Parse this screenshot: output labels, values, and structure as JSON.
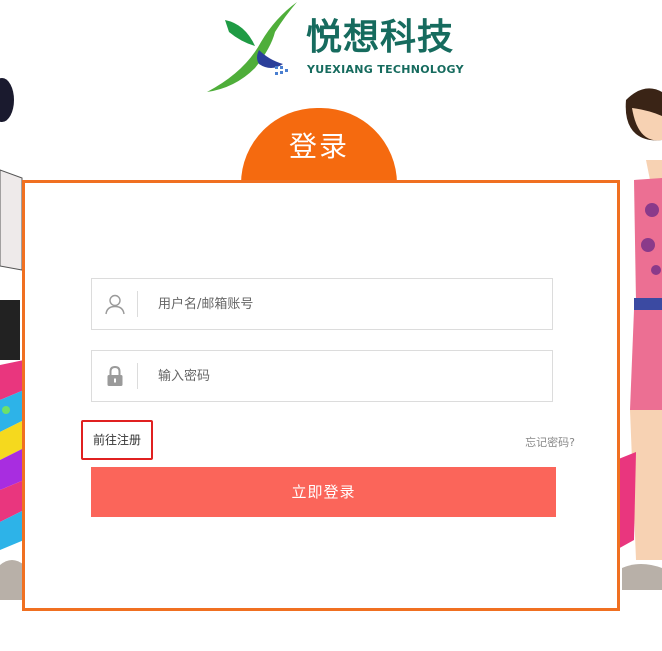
{
  "logo": {
    "cn": "悦想科技",
    "en": "YUEXIANG TECHNOLOGY"
  },
  "login_tab": {
    "label": "登录"
  },
  "form": {
    "username_placeholder": "用户名/邮箱账号",
    "password_placeholder": "输入密码",
    "register_label": "前往注册",
    "forgot_label": "忘记密码?",
    "submit_label": "立即登录"
  },
  "icons": {
    "logo": "x-shaped-leaf-logo",
    "username": "user-icon",
    "password": "lock-icon"
  },
  "colors": {
    "brand_green": "#166b5e",
    "tab_orange": "#f56a0f",
    "box_border": "#f07021",
    "button": "#fb655a",
    "highlight_red": "#e02020"
  }
}
